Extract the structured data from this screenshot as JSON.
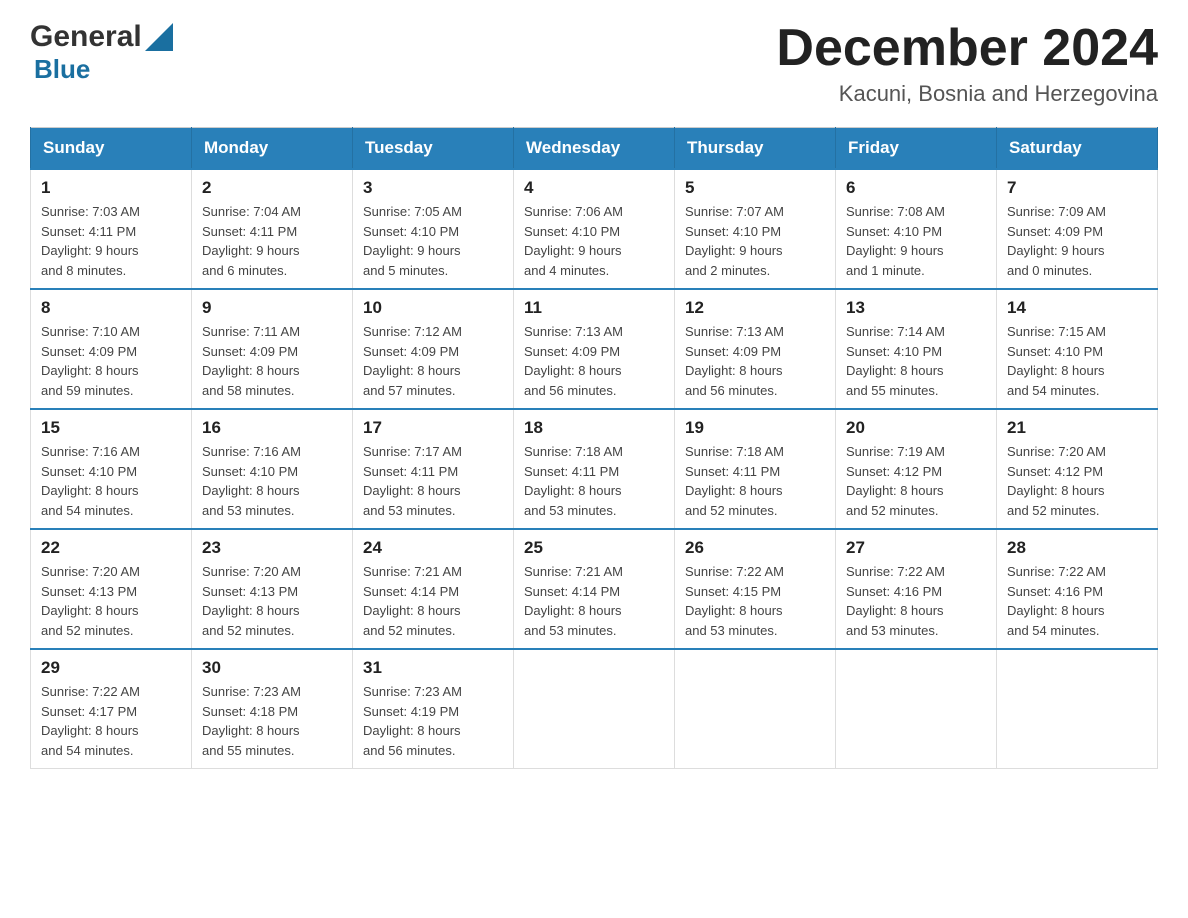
{
  "logo": {
    "line1": "General",
    "line2": "Blue"
  },
  "header": {
    "title": "December 2024",
    "subtitle": "Kacuni, Bosnia and Herzegovina"
  },
  "calendar": {
    "days_of_week": [
      "Sunday",
      "Monday",
      "Tuesday",
      "Wednesday",
      "Thursday",
      "Friday",
      "Saturday"
    ],
    "weeks": [
      [
        {
          "day": "1",
          "info": "Sunrise: 7:03 AM\nSunset: 4:11 PM\nDaylight: 9 hours\nand 8 minutes."
        },
        {
          "day": "2",
          "info": "Sunrise: 7:04 AM\nSunset: 4:11 PM\nDaylight: 9 hours\nand 6 minutes."
        },
        {
          "day": "3",
          "info": "Sunrise: 7:05 AM\nSunset: 4:10 PM\nDaylight: 9 hours\nand 5 minutes."
        },
        {
          "day": "4",
          "info": "Sunrise: 7:06 AM\nSunset: 4:10 PM\nDaylight: 9 hours\nand 4 minutes."
        },
        {
          "day": "5",
          "info": "Sunrise: 7:07 AM\nSunset: 4:10 PM\nDaylight: 9 hours\nand 2 minutes."
        },
        {
          "day": "6",
          "info": "Sunrise: 7:08 AM\nSunset: 4:10 PM\nDaylight: 9 hours\nand 1 minute."
        },
        {
          "day": "7",
          "info": "Sunrise: 7:09 AM\nSunset: 4:09 PM\nDaylight: 9 hours\nand 0 minutes."
        }
      ],
      [
        {
          "day": "8",
          "info": "Sunrise: 7:10 AM\nSunset: 4:09 PM\nDaylight: 8 hours\nand 59 minutes."
        },
        {
          "day": "9",
          "info": "Sunrise: 7:11 AM\nSunset: 4:09 PM\nDaylight: 8 hours\nand 58 minutes."
        },
        {
          "day": "10",
          "info": "Sunrise: 7:12 AM\nSunset: 4:09 PM\nDaylight: 8 hours\nand 57 minutes."
        },
        {
          "day": "11",
          "info": "Sunrise: 7:13 AM\nSunset: 4:09 PM\nDaylight: 8 hours\nand 56 minutes."
        },
        {
          "day": "12",
          "info": "Sunrise: 7:13 AM\nSunset: 4:09 PM\nDaylight: 8 hours\nand 56 minutes."
        },
        {
          "day": "13",
          "info": "Sunrise: 7:14 AM\nSunset: 4:10 PM\nDaylight: 8 hours\nand 55 minutes."
        },
        {
          "day": "14",
          "info": "Sunrise: 7:15 AM\nSunset: 4:10 PM\nDaylight: 8 hours\nand 54 minutes."
        }
      ],
      [
        {
          "day": "15",
          "info": "Sunrise: 7:16 AM\nSunset: 4:10 PM\nDaylight: 8 hours\nand 54 minutes."
        },
        {
          "day": "16",
          "info": "Sunrise: 7:16 AM\nSunset: 4:10 PM\nDaylight: 8 hours\nand 53 minutes."
        },
        {
          "day": "17",
          "info": "Sunrise: 7:17 AM\nSunset: 4:11 PM\nDaylight: 8 hours\nand 53 minutes."
        },
        {
          "day": "18",
          "info": "Sunrise: 7:18 AM\nSunset: 4:11 PM\nDaylight: 8 hours\nand 53 minutes."
        },
        {
          "day": "19",
          "info": "Sunrise: 7:18 AM\nSunset: 4:11 PM\nDaylight: 8 hours\nand 52 minutes."
        },
        {
          "day": "20",
          "info": "Sunrise: 7:19 AM\nSunset: 4:12 PM\nDaylight: 8 hours\nand 52 minutes."
        },
        {
          "day": "21",
          "info": "Sunrise: 7:20 AM\nSunset: 4:12 PM\nDaylight: 8 hours\nand 52 minutes."
        }
      ],
      [
        {
          "day": "22",
          "info": "Sunrise: 7:20 AM\nSunset: 4:13 PM\nDaylight: 8 hours\nand 52 minutes."
        },
        {
          "day": "23",
          "info": "Sunrise: 7:20 AM\nSunset: 4:13 PM\nDaylight: 8 hours\nand 52 minutes."
        },
        {
          "day": "24",
          "info": "Sunrise: 7:21 AM\nSunset: 4:14 PM\nDaylight: 8 hours\nand 52 minutes."
        },
        {
          "day": "25",
          "info": "Sunrise: 7:21 AM\nSunset: 4:14 PM\nDaylight: 8 hours\nand 53 minutes."
        },
        {
          "day": "26",
          "info": "Sunrise: 7:22 AM\nSunset: 4:15 PM\nDaylight: 8 hours\nand 53 minutes."
        },
        {
          "day": "27",
          "info": "Sunrise: 7:22 AM\nSunset: 4:16 PM\nDaylight: 8 hours\nand 53 minutes."
        },
        {
          "day": "28",
          "info": "Sunrise: 7:22 AM\nSunset: 4:16 PM\nDaylight: 8 hours\nand 54 minutes."
        }
      ],
      [
        {
          "day": "29",
          "info": "Sunrise: 7:22 AM\nSunset: 4:17 PM\nDaylight: 8 hours\nand 54 minutes."
        },
        {
          "day": "30",
          "info": "Sunrise: 7:23 AM\nSunset: 4:18 PM\nDaylight: 8 hours\nand 55 minutes."
        },
        {
          "day": "31",
          "info": "Sunrise: 7:23 AM\nSunset: 4:19 PM\nDaylight: 8 hours\nand 56 minutes."
        },
        {
          "day": "",
          "info": ""
        },
        {
          "day": "",
          "info": ""
        },
        {
          "day": "",
          "info": ""
        },
        {
          "day": "",
          "info": ""
        }
      ]
    ]
  }
}
